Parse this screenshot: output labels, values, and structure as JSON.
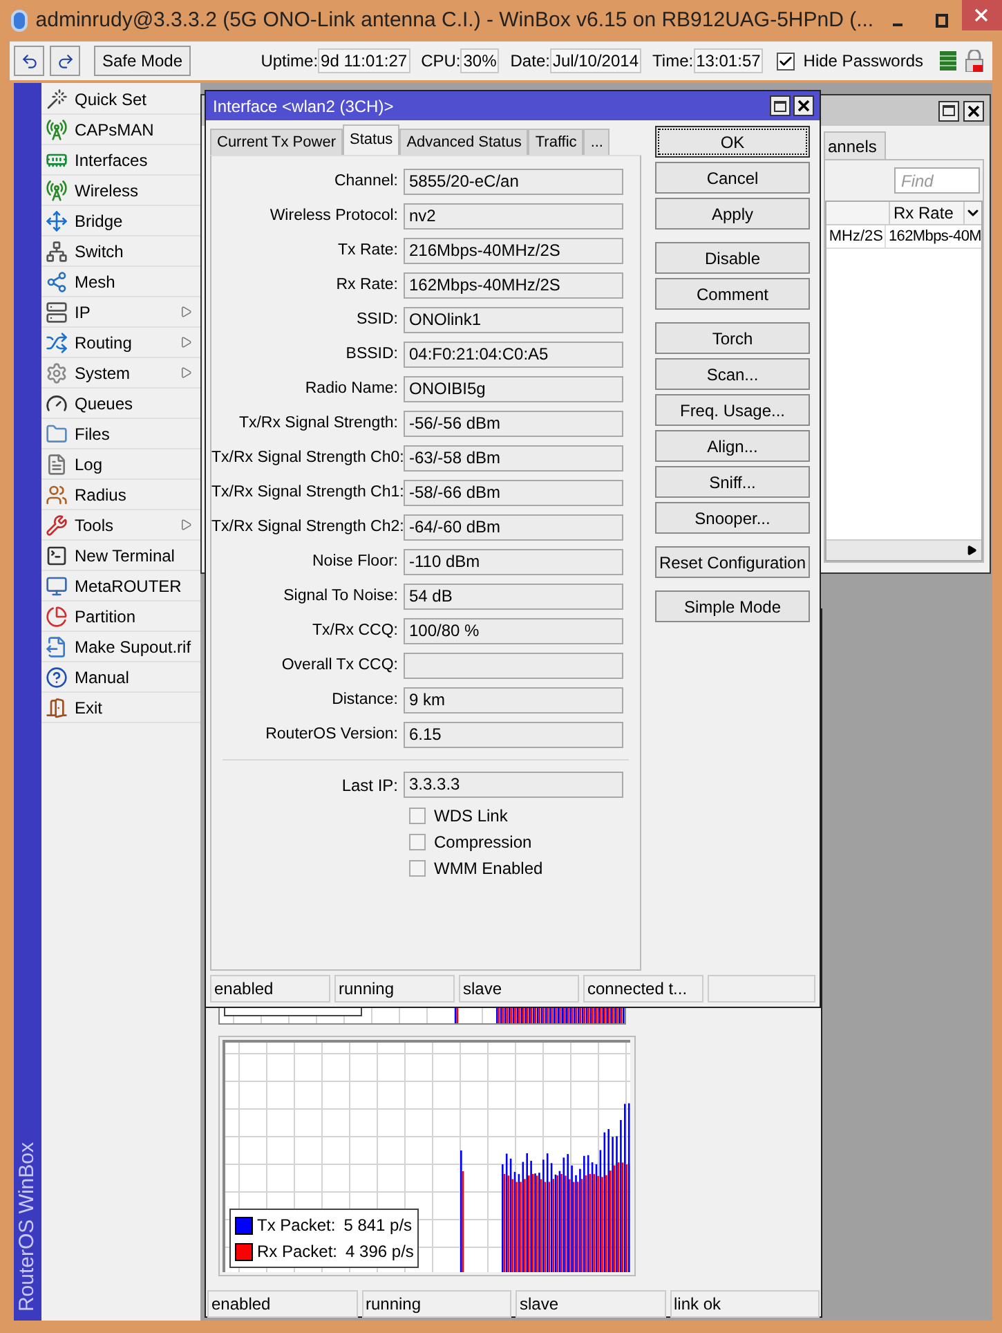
{
  "window": {
    "title": "adminrudy@3.3.3.2 (5G ONO-Link antenna C.I.) - WinBox v6.15 on RB912UAG-5HPnD (..."
  },
  "toolbar": {
    "safe_mode": "Safe Mode",
    "fields": [
      {
        "label": "Uptime:",
        "value": "9d 11:01:27"
      },
      {
        "label": "CPU:",
        "value": "30%"
      },
      {
        "label": "Date:",
        "value": "Jul/10/2014"
      },
      {
        "label": "Time:",
        "value": "13:01:57"
      }
    ],
    "hide_passwords": {
      "label": "Hide Passwords",
      "checked": true
    }
  },
  "side_label": "RouterOS WinBox",
  "menu": [
    {
      "label": "Quick Set",
      "submenu": false
    },
    {
      "label": "CAPsMAN",
      "submenu": false
    },
    {
      "label": "Interfaces",
      "submenu": false
    },
    {
      "label": "Wireless",
      "submenu": false
    },
    {
      "label": "Bridge",
      "submenu": false
    },
    {
      "label": "Switch",
      "submenu": false
    },
    {
      "label": "Mesh",
      "submenu": false
    },
    {
      "label": "IP",
      "submenu": true
    },
    {
      "label": "Routing",
      "submenu": true
    },
    {
      "label": "System",
      "submenu": true
    },
    {
      "label": "Queues",
      "submenu": false
    },
    {
      "label": "Files",
      "submenu": false
    },
    {
      "label": "Log",
      "submenu": false
    },
    {
      "label": "Radius",
      "submenu": false
    },
    {
      "label": "Tools",
      "submenu": true
    },
    {
      "label": "New Terminal",
      "submenu": false
    },
    {
      "label": "MetaROUTER",
      "submenu": false
    },
    {
      "label": "Partition",
      "submenu": false
    },
    {
      "label": "Make Supout.rif",
      "submenu": false
    },
    {
      "label": "Manual",
      "submenu": false
    },
    {
      "label": "Exit",
      "submenu": false
    }
  ],
  "back_window": {
    "tab": "annels",
    "find_placeholder": "Find",
    "columns": [
      "Rx Rate"
    ],
    "row": [
      "MHz/2S",
      "162Mbps-40M"
    ]
  },
  "interface_window": {
    "title": "Interface <wlan2 (3CH)>",
    "tabs": [
      {
        "label": "Current Tx Power",
        "selected": false
      },
      {
        "label": "Status",
        "selected": true
      },
      {
        "label": "Advanced Status",
        "selected": false
      },
      {
        "label": "Traffic",
        "selected": false
      },
      {
        "label": "...",
        "selected": false
      }
    ],
    "fields": [
      {
        "label": "Channel:",
        "value": "5855/20-eC/an"
      },
      {
        "label": "Wireless Protocol:",
        "value": "nv2"
      },
      {
        "label": "Tx Rate:",
        "value": "216Mbps-40MHz/2S"
      },
      {
        "label": "Rx Rate:",
        "value": "162Mbps-40MHz/2S"
      },
      {
        "label": "SSID:",
        "value": "ONOlink1"
      },
      {
        "label": "BSSID:",
        "value": "04:F0:21:04:C0:A5"
      },
      {
        "label": "Radio Name:",
        "value": "ONOIBI5g"
      },
      {
        "label": "Tx/Rx Signal Strength:",
        "value": "-56/-56 dBm"
      },
      {
        "label": "Tx/Rx Signal Strength Ch0:",
        "value": "-63/-58 dBm"
      },
      {
        "label": "Tx/Rx Signal Strength Ch1:",
        "value": "-58/-66 dBm"
      },
      {
        "label": "Tx/Rx Signal Strength Ch2:",
        "value": "-64/-60 dBm"
      },
      {
        "label": "Noise Floor:",
        "value": "-110 dBm"
      },
      {
        "label": "Signal To Noise:",
        "value": "54 dB"
      },
      {
        "label": "Tx/Rx CCQ:",
        "value": "100/80 %"
      },
      {
        "label": "Overall Tx CCQ:"
      },
      {
        "label": "Distance:",
        "value": "9 km"
      },
      {
        "label": "RouterOS Version:",
        "value": "6.15"
      }
    ],
    "last_ip": {
      "label": "Last IP:",
      "value": "3.3.3.3"
    },
    "checkboxes": [
      {
        "label": "WDS Link",
        "checked": false
      },
      {
        "label": "Compression",
        "checked": false
      },
      {
        "label": "WMM Enabled",
        "checked": false
      }
    ],
    "button_groups": [
      [
        {
          "label": "OK",
          "focused": true
        },
        {
          "label": "Cancel",
          "focused": false
        },
        {
          "label": "Apply",
          "focused": false
        }
      ],
      [
        {
          "label": "Disable",
          "focused": false
        },
        {
          "label": "Comment",
          "focused": false
        }
      ],
      [
        {
          "label": "Torch",
          "focused": false
        },
        {
          "label": "Scan...",
          "focused": false
        },
        {
          "label": "Freq. Usage...",
          "focused": false
        },
        {
          "label": "Align...",
          "focused": false
        },
        {
          "label": "Sniff...",
          "focused": false
        },
        {
          "label": "Snooper...",
          "focused": false
        }
      ],
      [
        {
          "label": "Reset Configuration",
          "focused": false
        }
      ],
      [
        {
          "label": "Simple Mode",
          "focused": false
        }
      ]
    ],
    "status_bar": [
      "enabled",
      "running",
      "slave",
      "connected t..."
    ]
  },
  "traffic_window": {
    "legend": [
      {
        "label": "Tx Packet:",
        "value": "5 841 p/s",
        "color": "#0000ff"
      },
      {
        "label": "Rx Packet:",
        "value": "4 396 p/s",
        "color": "#ff0000"
      }
    ],
    "status_bar": [
      "enabled",
      "running",
      "slave",
      "link ok"
    ]
  }
}
